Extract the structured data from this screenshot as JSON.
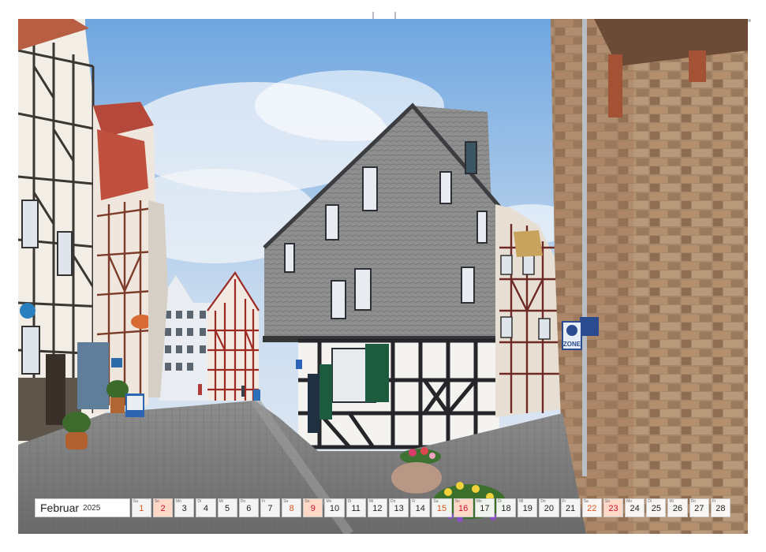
{
  "calendar": {
    "month": "Februar",
    "year": "2025",
    "days": [
      {
        "wd": "Sa",
        "n": "1",
        "type": "sat"
      },
      {
        "wd": "So",
        "n": "2",
        "type": "sun"
      },
      {
        "wd": "Mo",
        "n": "3",
        "type": ""
      },
      {
        "wd": "Di",
        "n": "4",
        "type": ""
      },
      {
        "wd": "Mi",
        "n": "5",
        "type": ""
      },
      {
        "wd": "Do",
        "n": "6",
        "type": ""
      },
      {
        "wd": "Fr",
        "n": "7",
        "type": ""
      },
      {
        "wd": "Sa",
        "n": "8",
        "type": "sat"
      },
      {
        "wd": "So",
        "n": "9",
        "type": "sun"
      },
      {
        "wd": "Mo",
        "n": "10",
        "type": ""
      },
      {
        "wd": "Di",
        "n": "11",
        "type": ""
      },
      {
        "wd": "Mi",
        "n": "12",
        "type": ""
      },
      {
        "wd": "Do",
        "n": "13",
        "type": ""
      },
      {
        "wd": "Fr",
        "n": "14",
        "type": ""
      },
      {
        "wd": "Sa",
        "n": "15",
        "type": "sat"
      },
      {
        "wd": "So",
        "n": "16",
        "type": "sun"
      },
      {
        "wd": "Mo",
        "n": "17",
        "type": ""
      },
      {
        "wd": "Di",
        "n": "18",
        "type": ""
      },
      {
        "wd": "Mi",
        "n": "19",
        "type": ""
      },
      {
        "wd": "Do",
        "n": "20",
        "type": ""
      },
      {
        "wd": "Fr",
        "n": "21",
        "type": ""
      },
      {
        "wd": "Sa",
        "n": "22",
        "type": "sat"
      },
      {
        "wd": "So",
        "n": "23",
        "type": "sun"
      },
      {
        "wd": "Mo",
        "n": "24",
        "type": ""
      },
      {
        "wd": "Di",
        "n": "25",
        "type": ""
      },
      {
        "wd": "Mi",
        "n": "26",
        "type": ""
      },
      {
        "wd": "Do",
        "n": "27",
        "type": ""
      },
      {
        "wd": "Fr",
        "n": "28",
        "type": ""
      }
    ]
  },
  "signs": {
    "zone": "ZONE"
  },
  "colors": {
    "weekend": "#c8102e",
    "saturday": "#d9541e"
  }
}
